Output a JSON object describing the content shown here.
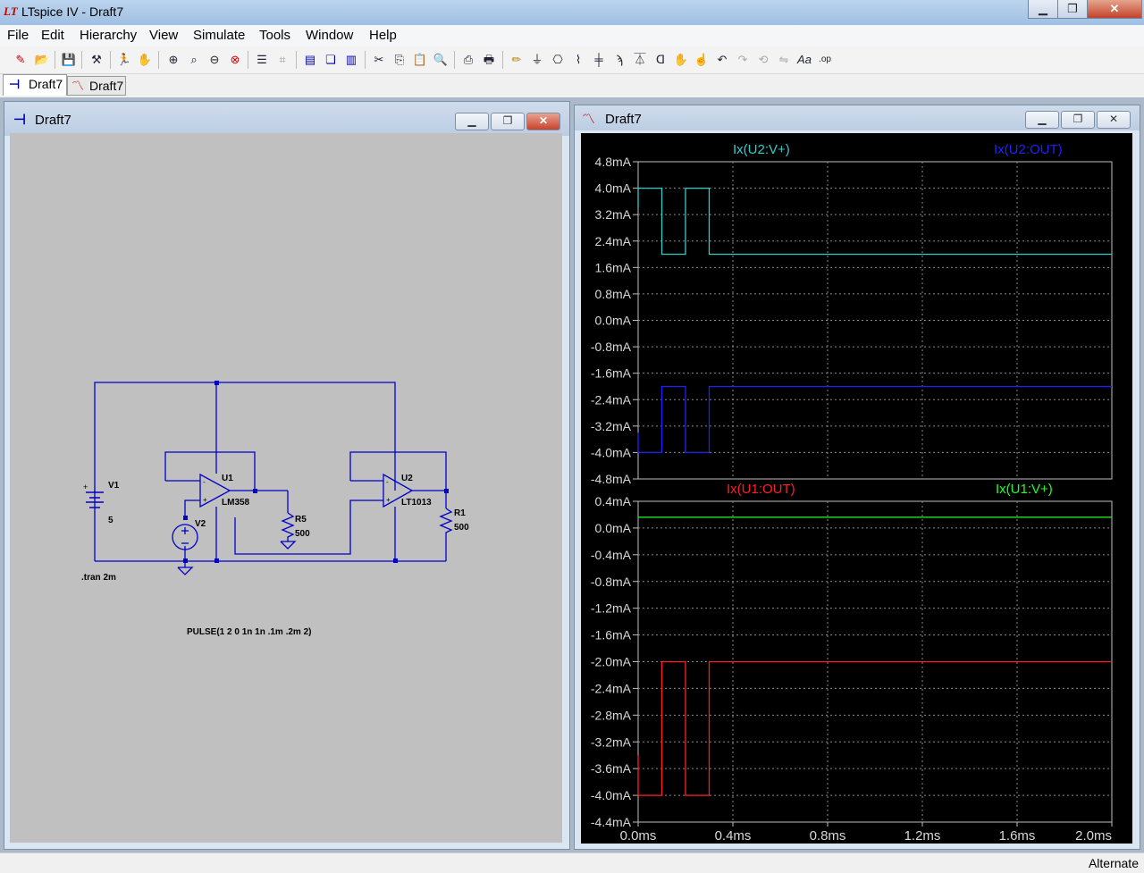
{
  "window": {
    "title": "LTspice IV - Draft7"
  },
  "menu": [
    "File",
    "Edit",
    "Hierarchy",
    "View",
    "Simulate",
    "Tools",
    "Window",
    "Help"
  ],
  "tabs": [
    {
      "label": "Draft7",
      "icon": "schematic-icon"
    },
    {
      "label": "Draft7",
      "icon": "waveform-icon"
    }
  ],
  "schematic_window": {
    "title": "Draft7",
    "components": {
      "v1_name": "V1",
      "v1_value": "5",
      "v2_name": "V2",
      "u1_name": "U1",
      "u1_model": "LM358",
      "u2_name": "U2",
      "u2_model": "LT1013",
      "r5_name": "R5",
      "r5_value": "500",
      "r1_name": "R1",
      "r1_value": "500"
    },
    "directive": ".tran 2m",
    "pulse": "PULSE(1 2 0 1n 1n .1m .2m 2)"
  },
  "waveform_window": {
    "title": "Draft7",
    "colors": {
      "u2_vplus": "#33cccc",
      "u2_out": "#2020ff",
      "u1_out": "#ff2020",
      "u1_vplus": "#20ff20"
    }
  },
  "chart_data": [
    {
      "type": "line",
      "x_unit": "ms",
      "xlim": [
        0,
        2
      ],
      "ylim": [
        -4.8,
        4.8
      ],
      "yticks": [
        "4.8mA",
        "4.0mA",
        "3.2mA",
        "2.4mA",
        "1.6mA",
        "0.8mA",
        "0.0mA",
        "-0.8mA",
        "-1.6mA",
        "-2.4mA",
        "-3.2mA",
        "-4.0mA",
        "-4.8mA"
      ],
      "series": [
        {
          "name": "Ix(U2:V+)",
          "color": "#33cccc",
          "x": [
            0,
            0,
            0.1,
            0.1,
            0.2,
            0.2,
            0.3,
            0.3,
            2.0
          ],
          "y": [
            3.4,
            4.0,
            4.0,
            2.0,
            2.0,
            4.0,
            4.0,
            2.0,
            2.0
          ]
        },
        {
          "name": "Ix(U2:OUT)",
          "color": "#2020ff",
          "x": [
            0,
            0,
            0.1,
            0.1,
            0.2,
            0.2,
            0.3,
            0.3,
            2.0
          ],
          "y": [
            -3.4,
            -4.0,
            -4.0,
            -2.0,
            -2.0,
            -4.0,
            -4.0,
            -2.0,
            -2.0
          ]
        }
      ]
    },
    {
      "type": "line",
      "x_unit": "ms",
      "xlim": [
        0,
        2
      ],
      "ylim": [
        -4.4,
        0.4
      ],
      "yticks": [
        "0.4mA",
        "0.0mA",
        "-0.4mA",
        "-0.8mA",
        "-1.2mA",
        "-1.6mA",
        "-2.0mA",
        "-2.4mA",
        "-2.8mA",
        "-3.2mA",
        "-3.6mA",
        "-4.0mA",
        "-4.4mA"
      ],
      "xticks": [
        "0.0ms",
        "0.4ms",
        "0.8ms",
        "1.2ms",
        "1.6ms",
        "2.0ms"
      ],
      "series": [
        {
          "name": "Ix(U1:OUT)",
          "color": "#ff2020",
          "x": [
            0,
            0,
            0.1,
            0.1,
            0.2,
            0.2,
            0.3,
            0.3,
            2.0
          ],
          "y": [
            -3.4,
            -4.0,
            -4.0,
            -2.0,
            -2.0,
            -4.0,
            -4.0,
            -2.0,
            -2.0
          ]
        },
        {
          "name": "Ix(U1:V+)",
          "color": "#20ff20",
          "x": [
            0,
            2.0
          ],
          "y": [
            0.16,
            0.16
          ]
        }
      ]
    }
  ],
  "status": "Alternate"
}
